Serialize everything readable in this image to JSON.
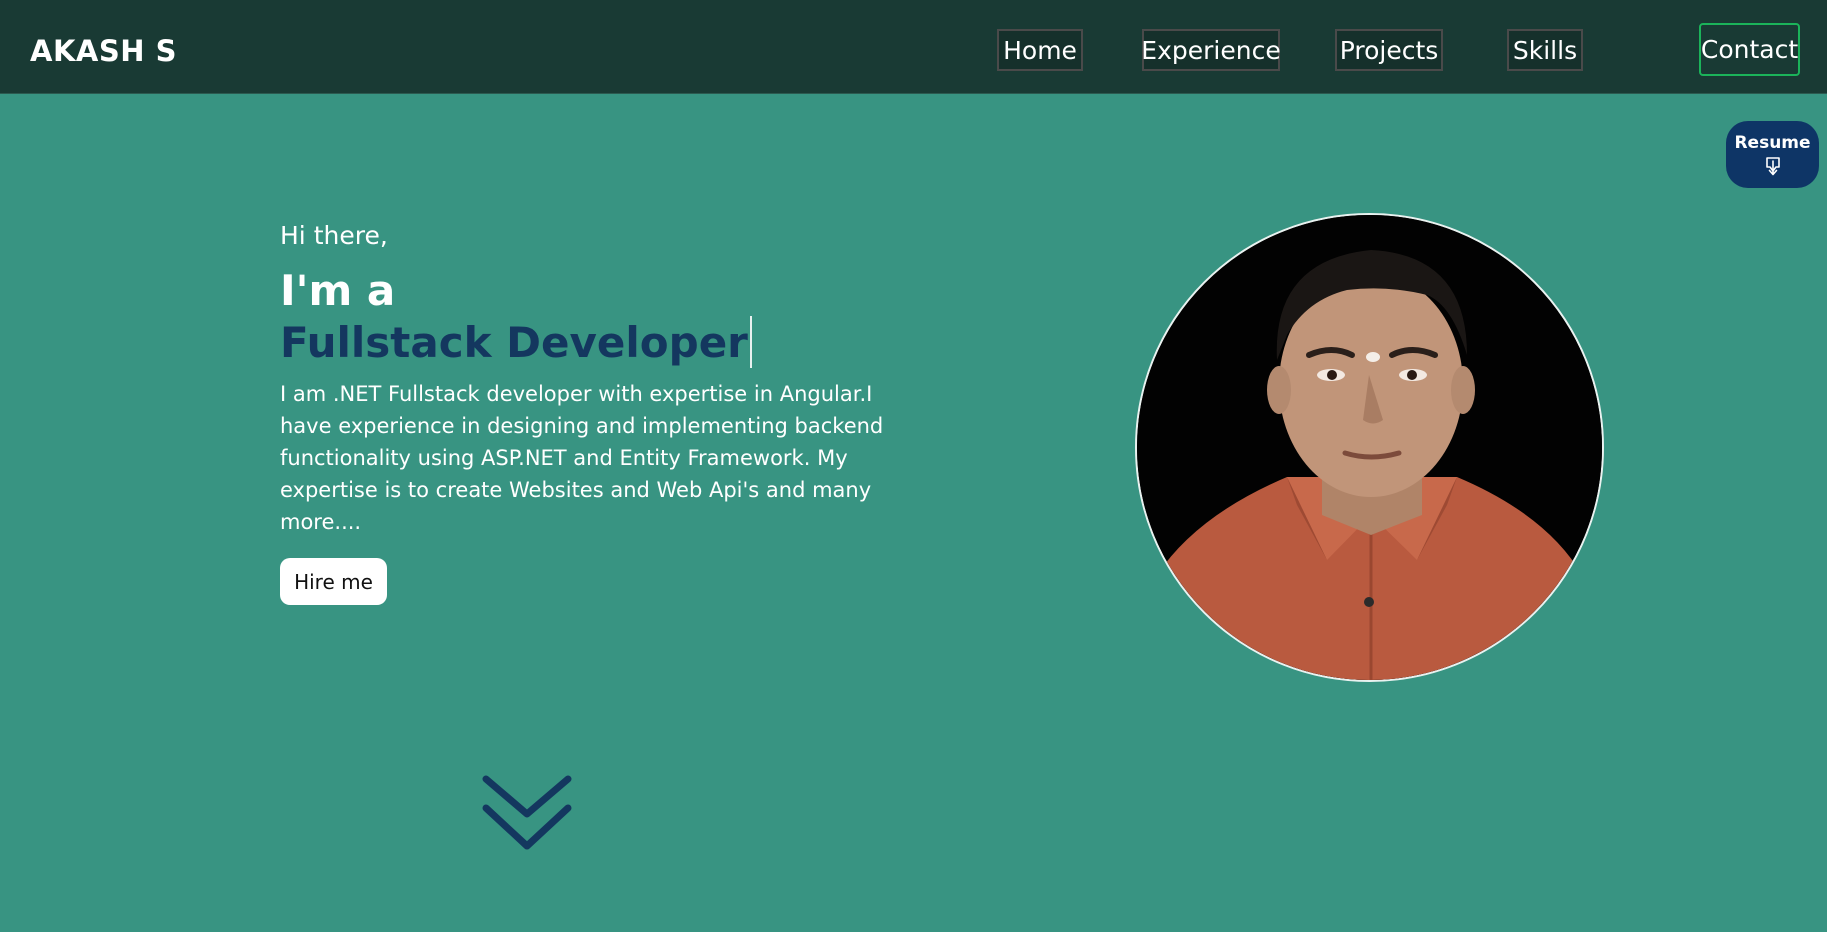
{
  "nav": {
    "brand": "AKASH S",
    "items": [
      {
        "label": "Home"
      },
      {
        "label": "Experience"
      },
      {
        "label": "Projects"
      },
      {
        "label": "Skills"
      }
    ],
    "contact_label": "Contact"
  },
  "resume": {
    "label": "Resume",
    "icon": "download-icon"
  },
  "hero": {
    "greeting": "Hi there,",
    "intro": "I'm a",
    "role": "Fullstack Developer",
    "bio": "I am .NET Fullstack developer with expertise in Angular.I have experience in designing and implementing backend functionality using ASP.NET and Entity Framework. My expertise is to create Websites and Web Api's and many more....",
    "hire_label": "Hire me",
    "scroll_icon": "double-chevron-down-icon"
  },
  "colors": {
    "background": "#389482",
    "navbar": "#193a34",
    "accent": "#14375f",
    "contact_border": "#1bb35a"
  }
}
